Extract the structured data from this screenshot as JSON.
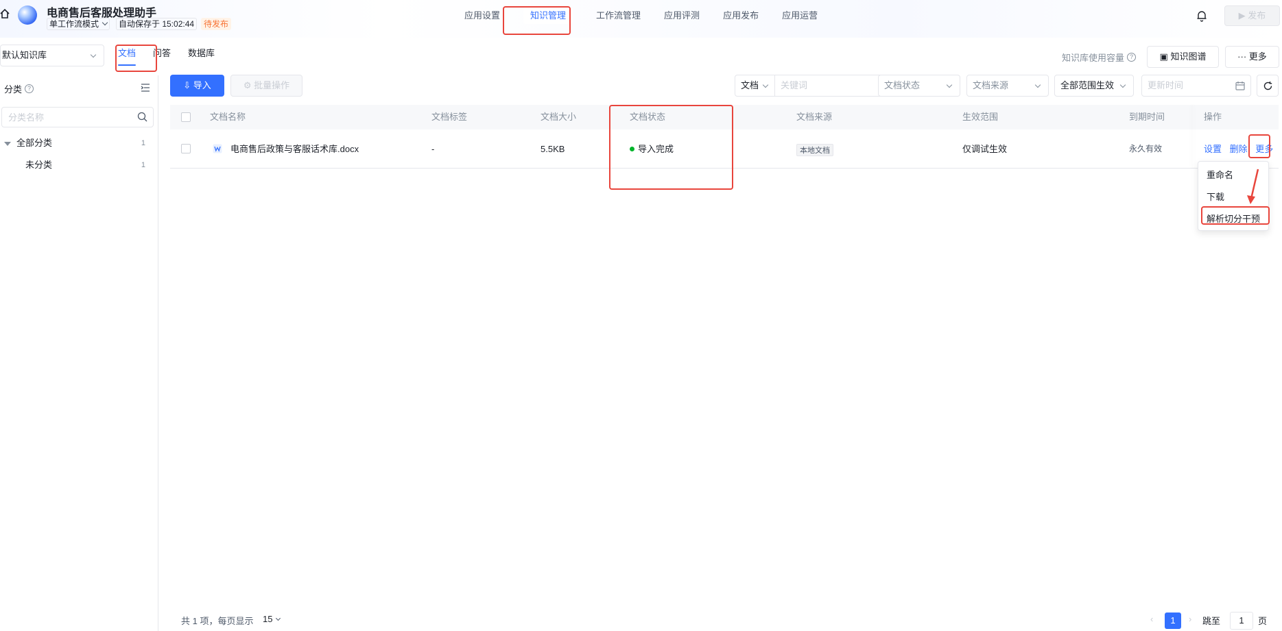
{
  "header": {
    "app_title": "电商售后客服处理助手",
    "mode": "单工作流模式",
    "autosave": "自动保存于 15:02:44",
    "status_badge": "待发布",
    "publish_label": "发布",
    "nav_tabs": [
      "应用设置",
      "知识管理",
      "工作流管理",
      "应用评测",
      "应用发布",
      "应用运营"
    ],
    "active_tab": "知识管理"
  },
  "subheader": {
    "kb_select": "默认知识库",
    "tabs": [
      "文档",
      "问答",
      "数据库"
    ],
    "active_tab": "文档",
    "usage_label": "知识库使用容量",
    "kgraph_label": "知识图谱",
    "more_label": "更多"
  },
  "sidebar": {
    "title": "分类",
    "search_placeholder": "分类名称",
    "tree": [
      {
        "label": "全部分类",
        "count": "1"
      },
      {
        "label": "未分类",
        "count": "1"
      }
    ]
  },
  "toolbar": {
    "import_label": "导入",
    "batch_label": "批量操作",
    "keyword_type": "文档",
    "keyword_placeholder": "关键词",
    "status_filter": "文档状态",
    "source_filter": "文档来源",
    "scope_filter": "全部范围生效",
    "time_placeholder": "更新时间"
  },
  "table": {
    "columns": [
      "文档名称",
      "文档标签",
      "文档大小",
      "文档状态",
      "文档来源",
      "生效范围",
      "到期时间",
      "操作"
    ],
    "rows": [
      {
        "name": "电商售后政策与客服话术库.docx",
        "tag": "-",
        "size": "5.5KB",
        "status": "导入完成",
        "source": "本地文档",
        "scope": "仅调试生效",
        "expiry": "永久有效",
        "ops": [
          "设置",
          "删除",
          "更多"
        ]
      }
    ]
  },
  "dropdown": {
    "items": [
      "重命名",
      "下载",
      "解析切分干预"
    ]
  },
  "pagination": {
    "total_text": "共 1 项，每页显示",
    "page_size": "15",
    "current_page": "1",
    "jump_label": "跳至",
    "jump_value": "1",
    "page_suffix": "页"
  },
  "colors": {
    "primary": "#3370ff",
    "annotation": "#e8453c",
    "success": "#00b42a",
    "badge": "#f77234"
  }
}
